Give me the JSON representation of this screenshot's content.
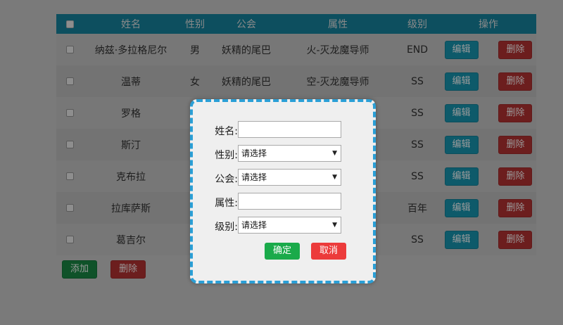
{
  "table": {
    "headers": {
      "name": "姓名",
      "gender": "性别",
      "guild": "公会",
      "attribute": "属性",
      "level": "级别",
      "actions": "操作"
    },
    "rows": [
      {
        "name": "纳兹·多拉格尼尔",
        "gender": "男",
        "guild": "妖精的尾巴",
        "attribute": "火-灭龙魔导师",
        "level": "END"
      },
      {
        "name": "温蒂",
        "gender": "女",
        "guild": "妖精的尾巴",
        "attribute": "空-灭龙魔导师",
        "level": "SS"
      },
      {
        "name": "罗格",
        "gender": "",
        "guild": "",
        "attribute": "",
        "level": "SS"
      },
      {
        "name": "斯汀",
        "gender": "",
        "guild": "",
        "attribute": "",
        "level": "SS"
      },
      {
        "name": "克布拉",
        "gender": "",
        "guild": "",
        "attribute": "",
        "level": "SS"
      },
      {
        "name": "拉库萨斯",
        "gender": "",
        "guild": "",
        "attribute": "",
        "level": "百年"
      },
      {
        "name": "葛吉尔",
        "gender": "",
        "guild": "",
        "attribute": "",
        "level": "SS"
      }
    ],
    "edit_label": "编辑",
    "delete_label": "删除"
  },
  "bottom": {
    "add_label": "添加",
    "delete_label": "删除"
  },
  "modal": {
    "name_label": "姓名:",
    "name_value": "",
    "gender_label": "性别:",
    "gender_selected": "请选择",
    "guild_label": "公会:",
    "guild_selected": "请选择",
    "attribute_label": "属性:",
    "attribute_value": "",
    "level_label": "级别:",
    "level_selected": "请选择",
    "ok_label": "确定",
    "cancel_label": "取消"
  },
  "colors": {
    "header_bg": "#0d4f5f",
    "modal_border": "#2a9fd6",
    "ok_button": "#1aaa4a",
    "cancel_button": "#ec3b3b"
  }
}
